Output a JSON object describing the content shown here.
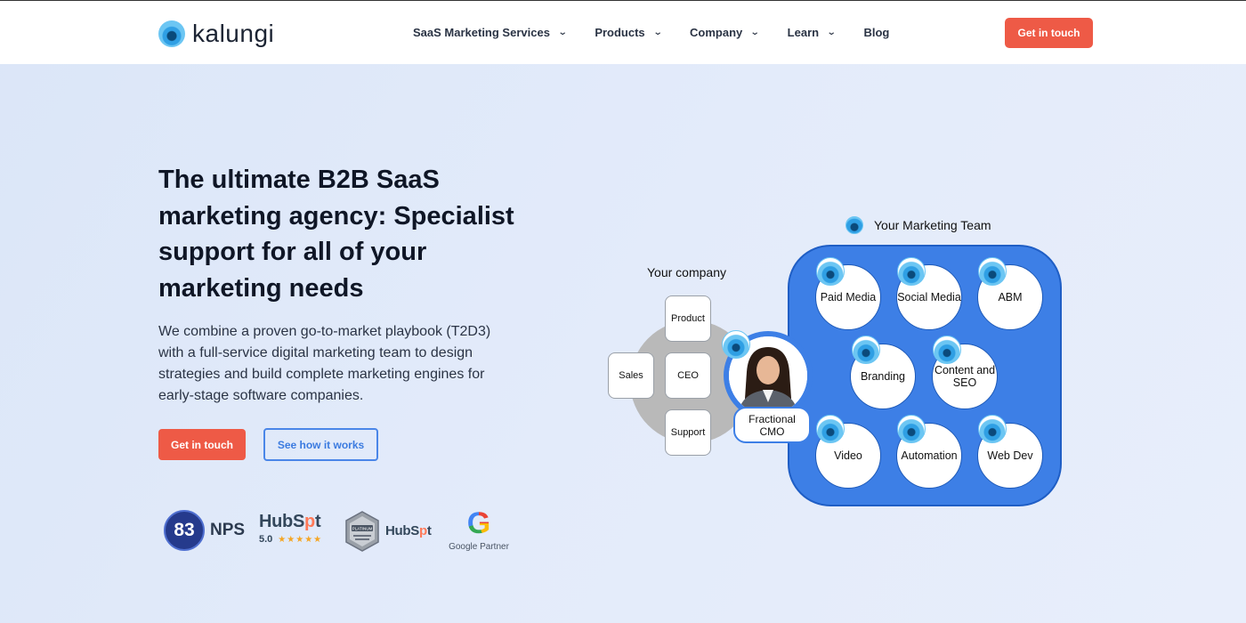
{
  "nav": {
    "logo_text": "kalungi",
    "menu": [
      {
        "label": "SaaS Marketing Services",
        "has_dropdown": true
      },
      {
        "label": "Products",
        "has_dropdown": true
      },
      {
        "label": "Company",
        "has_dropdown": true
      },
      {
        "label": "Learn",
        "has_dropdown": true
      },
      {
        "label": "Blog",
        "has_dropdown": false
      }
    ],
    "cta": "Get in touch",
    "chevron": "⌄"
  },
  "hero": {
    "title": "The ultimate B2B SaaS marketing agency: Specialist support for all of your marketing needs",
    "description": "We combine a proven go-to-market playbook (T2D3) with a full-service digital marketing team to design strategies and build complete marketing engines for early-stage software companies.",
    "primary_cta": "Get in touch",
    "secondary_cta": "See how it works"
  },
  "badges": {
    "nps_score": "83",
    "nps_label": "NPS",
    "hubspot_word_a": "HubS",
    "hubspot_word_o": "p",
    "hubspot_word_b": "t",
    "hubspot_rating": "5.0",
    "hubspot_stars": "★★★★★",
    "platinum_label": "PLATINUM",
    "hubspot2_a": "HubS",
    "hubspot2_o": "p",
    "hubspot2_b": "t",
    "google_mark": "G",
    "google_label": "Google Partner"
  },
  "diagram": {
    "team_title": "Your Marketing Team",
    "company_title": "Your company",
    "company_roles": {
      "product": "Product",
      "sales": "Sales",
      "ceo": "CEO",
      "support": "Support"
    },
    "cmo_label": "Fractional CMO",
    "services": [
      "Paid Media",
      "Social Media",
      "ABM",
      "Branding",
      "Content and SEO",
      "Video",
      "Automation",
      "Web Dev"
    ]
  },
  "colors": {
    "accent": "#ee5a46",
    "blue": "#3d7fe6",
    "nps_blue": "#253a8c",
    "hubspot_orange": "#ff7a59"
  }
}
